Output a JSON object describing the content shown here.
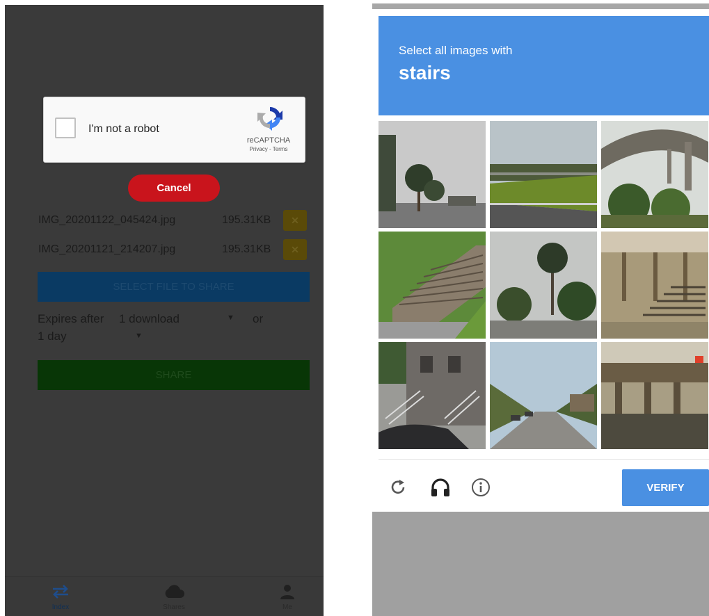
{
  "recaptcha_widget": {
    "checkbox_label": "I'm not a robot",
    "brand": "reCAPTCHA",
    "links": "Privacy - Terms"
  },
  "cancel_label": "Cancel",
  "files": [
    {
      "name": "IMG_20201122_045424.jpg",
      "size": "195.31KB",
      "remove_icon": "close-icon"
    },
    {
      "name": "IMG_20201121_214207.jpg",
      "size": "195.31KB",
      "remove_icon": "close-icon"
    }
  ],
  "select_file_label": "SELECT FILE TO SHARE",
  "expires": {
    "label": "Expires after",
    "count_value": "1 download",
    "or_text": "or",
    "days_value": "1 day"
  },
  "share_label": "SHARE",
  "bottom_nav": [
    {
      "label": "Index",
      "icon": "transfer-arrows-icon",
      "active": true
    },
    {
      "label": "Shares",
      "icon": "cloud-icon",
      "active": false
    },
    {
      "label": "Me",
      "icon": "person-icon",
      "active": false
    }
  ],
  "challenge": {
    "instruction": "Select all images with",
    "target": "stairs",
    "tiles": [
      {
        "scene": "palm trees under overcast sky"
      },
      {
        "scene": "highway overpass with grass embankment"
      },
      {
        "scene": "bridge arch with trees"
      },
      {
        "scene": "outdoor stairs beside grass"
      },
      {
        "scene": "palm tree over street"
      },
      {
        "scene": "stairs under building overhang"
      },
      {
        "scene": "building with front stairs and parked car"
      },
      {
        "scene": "road with cars and trees"
      },
      {
        "scene": "overpass structure with pillars"
      }
    ],
    "reload_icon": "reload-icon",
    "audio_icon": "headphones-icon",
    "info_icon": "info-icon",
    "verify_label": "VERIFY"
  },
  "colors": {
    "overlay_bg": "#3a3a3a",
    "cancel": "#c9141c",
    "challenge_blue": "#4a90e2"
  }
}
